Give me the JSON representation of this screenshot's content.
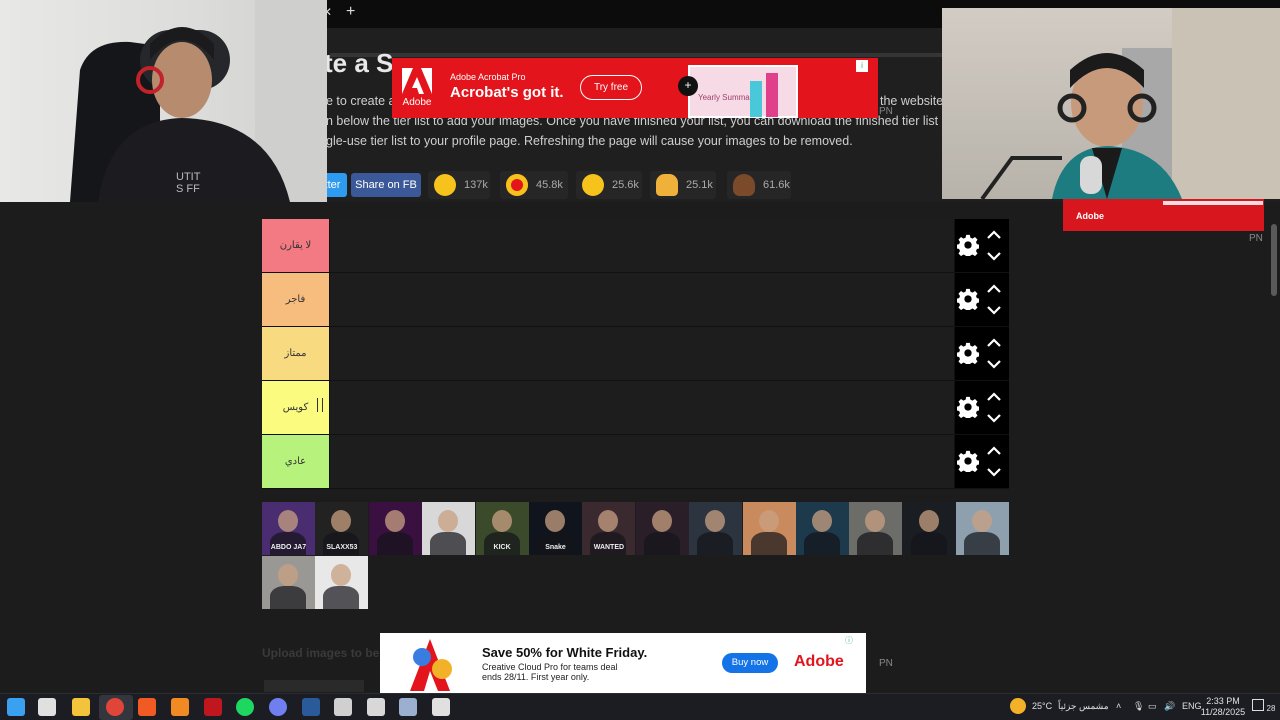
{
  "page": {
    "heading": "te a S",
    "paragraph_lines": [
      "e to create a s",
      "n below the tier list to add your images. Once you have finished your list, you can download the finished tier list image. It is",
      "gle-use tier list to your profile page. Refreshing the page will cause your images to be removed."
    ],
    "para_right_fragment": "the website."
  },
  "share": {
    "twitter_label": "tter",
    "facebook_label": "Share on FB"
  },
  "reactions": [
    {
      "emoji": "grinning-face",
      "count": "137k",
      "color": "#f6c21c"
    },
    {
      "emoji": "star-struck-face",
      "count": "45.8k",
      "color": "#f6c21c"
    },
    {
      "emoji": "tears-of-joy-face",
      "count": "25.6k",
      "color": "#f6c21c"
    },
    {
      "emoji": "raised-hands",
      "count": "25.1k",
      "color": "#f0b13a"
    },
    {
      "emoji": "pile-of-poo",
      "count": "61.6k",
      "color": "#7a4a2a"
    }
  ],
  "tiers": [
    {
      "label": "لا يقارن",
      "color": "#f37a82"
    },
    {
      "label": "فاجر",
      "color": "#f7bd7e"
    },
    {
      "label": "ممتاز",
      "color": "#f8db81"
    },
    {
      "label": "كويس",
      "color": "#fbfb80"
    },
    {
      "label": "عادي",
      "color": "#b7f27c"
    }
  ],
  "pool_images": [
    {
      "name": "abdo-ja7",
      "text": "ABDO JA7",
      "bg": "#4a2c70"
    },
    {
      "name": "slaxx53",
      "text": "SLAXX53",
      "bg": "#222"
    },
    {
      "name": "purple-avatar",
      "text": "",
      "bg": "#3a1040"
    },
    {
      "name": "person-white",
      "text": "",
      "bg": "#d8d8d8"
    },
    {
      "name": "kick-streamer",
      "text": "KICK",
      "bg": "#3c4a2c"
    },
    {
      "name": "snake-logo",
      "text": "Snake",
      "bg": "#10141c"
    },
    {
      "name": "wanted-poster",
      "text": "WANTED",
      "bg": "#3a2a30"
    },
    {
      "name": "dark-circle",
      "text": "",
      "bg": "#2a1e28"
    },
    {
      "name": "person-jacket",
      "text": "",
      "bg": "#2c3440"
    },
    {
      "name": "person-orange",
      "text": "",
      "bg": "#c98a5e"
    },
    {
      "name": "person-blue-bg",
      "text": "",
      "bg": "#1c3a4c"
    },
    {
      "name": "person-street",
      "text": "",
      "bg": "#6c6c68"
    },
    {
      "name": "person-night",
      "text": "",
      "bg": "#1a1e22"
    },
    {
      "name": "person-sea",
      "text": "",
      "bg": "#8ea0ae"
    },
    {
      "name": "person-mall",
      "text": "",
      "bg": "#9a9894"
    },
    {
      "name": "anime-sketch",
      "text": "",
      "bg": "#e8e8e8"
    }
  ],
  "ads": {
    "top": {
      "subtitle": "Adobe Acrobat Pro",
      "headline": "Acrobat's got it.",
      "cta": "Try free",
      "logo_text": "Adobe",
      "preview_text": "Yearly Summary",
      "color": "#e3141b"
    },
    "right": {
      "logo_text": "Adobe"
    },
    "bottom": {
      "headline": "Save 50% for White Friday.",
      "line1": "Creative Cloud Pro for teams deal",
      "line2": "ends 28/11. First year only.",
      "cta": "Buy now",
      "brand": "Adobe"
    },
    "pn_label": "PN"
  },
  "faded_text": "Upload images to be",
  "taskbar": {
    "weather": "25°C",
    "weather_desc": "مشمس جزئياً",
    "language": "ENG",
    "time": "2:33 PM",
    "date": "11/28/2025",
    "notifications": "28"
  },
  "taskbar_apps": [
    {
      "name": "start",
      "color": "#3aa0f0"
    },
    {
      "name": "task-view",
      "color": "#e0e0e0"
    },
    {
      "name": "file-explorer",
      "color": "#f3c33b"
    },
    {
      "name": "chrome",
      "color": "#e0453a"
    },
    {
      "name": "brave",
      "color": "#f25a24"
    },
    {
      "name": "app-orange",
      "color": "#f28a24"
    },
    {
      "name": "app-red",
      "color": "#c0161e"
    },
    {
      "name": "spotify",
      "color": "#1ed760"
    },
    {
      "name": "discord",
      "color": "#6f7ff0"
    },
    {
      "name": "steam",
      "color": "#2a5a9a"
    },
    {
      "name": "app-dark",
      "color": "#d0d0d0"
    },
    {
      "name": "app-arrow",
      "color": "#d8d8d8"
    },
    {
      "name": "app-multi",
      "color": "#9bb0d0"
    },
    {
      "name": "settings",
      "color": "#e0e0e0"
    }
  ]
}
